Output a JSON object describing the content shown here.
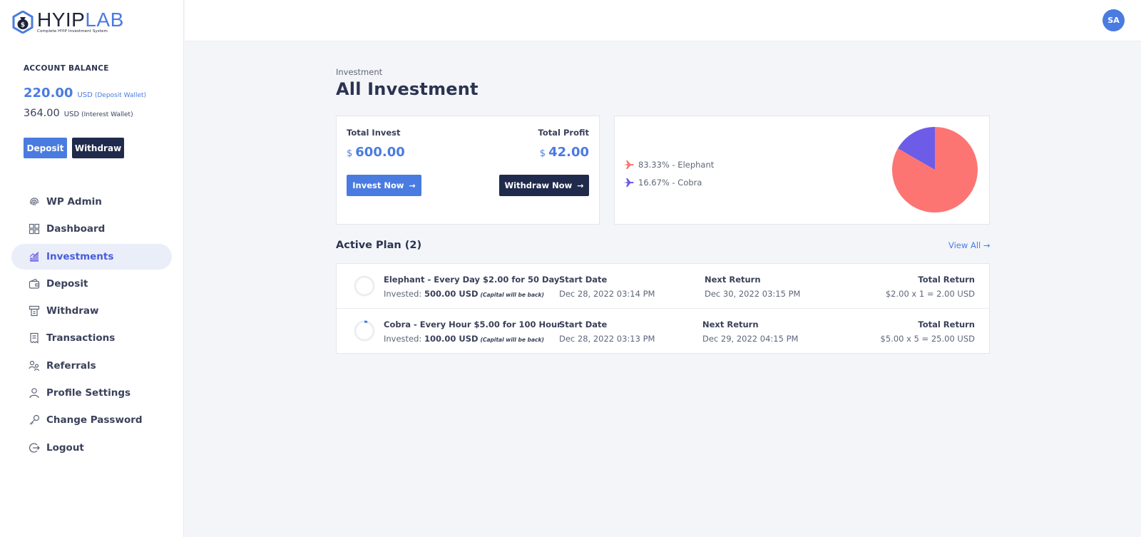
{
  "brand": {
    "name_a": "HYIP",
    "name_b": "LAB",
    "tagline": "Complete HYIP Investment System"
  },
  "account": {
    "label": "ACCOUNT BALANCE",
    "deposit_amount": "220.00",
    "deposit_currency": "USD",
    "deposit_wallet": "(Deposit Wallet)",
    "interest_amount": "364.00",
    "interest_currency": "USD",
    "interest_wallet": "(Interest Wallet)",
    "deposit_btn": "Deposit",
    "withdraw_btn": "Withdraw"
  },
  "nav": [
    {
      "label": "WP Admin",
      "icon": "fingerprint-icon"
    },
    {
      "label": "Dashboard",
      "icon": "grid-icon"
    },
    {
      "label": "Investments",
      "icon": "chart-growth-icon",
      "active": true
    },
    {
      "label": "Deposit",
      "icon": "wallet-icon"
    },
    {
      "label": "Withdraw",
      "icon": "atm-icon"
    },
    {
      "label": "Transactions",
      "icon": "receipt-icon"
    },
    {
      "label": "Referrals",
      "icon": "users-icon"
    },
    {
      "label": "Profile Settings",
      "icon": "user-icon"
    },
    {
      "label": "Change Password",
      "icon": "key-icon"
    },
    {
      "label": "Logout",
      "icon": "logout-icon"
    }
  ],
  "user": {
    "initials": "SA"
  },
  "page": {
    "breadcrumb": "Investment",
    "title": "All Investment"
  },
  "summary": {
    "invest_label": "Total Invest",
    "invest_currency": "$",
    "invest_value": "600.00",
    "profit_label": "Total Profit",
    "profit_currency": "$",
    "profit_value": "42.00",
    "invest_btn": "Invest Now",
    "withdraw_btn": "Withdraw Now"
  },
  "legend": [
    {
      "text": "83.33% - Elephant",
      "color": "#fc7573"
    },
    {
      "text": "16.67% - Cobra",
      "color": "#6c5ce7"
    }
  ],
  "chart_data": {
    "type": "pie",
    "categories": [
      "Elephant",
      "Cobra"
    ],
    "values": [
      83.33,
      16.67
    ],
    "colors": [
      "#fc7573",
      "#6c5ce7"
    ]
  },
  "active_plans": {
    "title": "Active Plan (2)",
    "view_all": "View All",
    "rows": [
      {
        "name": "Elephant - Every Day $2.00 for 50 Day",
        "invested_label": "Invested:",
        "invested_value": "500.00 USD",
        "note": "(Capital will be back)",
        "start_label": "Start Date",
        "start_value": "Dec 28, 2022 03:14 PM",
        "next_label": "Next Return",
        "next_value": "Dec 30, 2022 03:15 PM",
        "total_label": "Total Return",
        "total_value": "$2.00 x 1 = 2.00 USD",
        "progress": 0
      },
      {
        "name": "Cobra - Every Hour $5.00 for 100 Hour",
        "invested_label": "Invested:",
        "invested_value": "100.00 USD",
        "note": "(Capital will be back)",
        "start_label": "Start Date",
        "start_value": "Dec 28, 2022 03:13 PM",
        "next_label": "Next Return",
        "next_value": "Dec 29, 2022 04:15 PM",
        "total_label": "Total Return",
        "total_value": "$5.00 x 5 = 25.00 USD",
        "progress": 0.05
      }
    ]
  }
}
